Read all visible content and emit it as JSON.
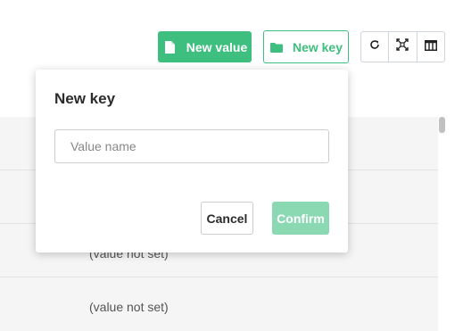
{
  "toolbar": {
    "new_value_label": "New value",
    "new_key_label": "New key",
    "icons": [
      "refresh-icon",
      "expand-icon",
      "columns-icon"
    ],
    "accent_color": "#3fbf7f"
  },
  "table": {
    "rows": [
      {
        "value": ""
      },
      {
        "value": ""
      },
      {
        "value": "(value not set)"
      },
      {
        "value": "(value not set)"
      }
    ]
  },
  "new_key_dialog": {
    "title": "New key",
    "input_placeholder": "Value name",
    "input_value": "",
    "cancel_label": "Cancel",
    "confirm_label": "Confirm"
  }
}
